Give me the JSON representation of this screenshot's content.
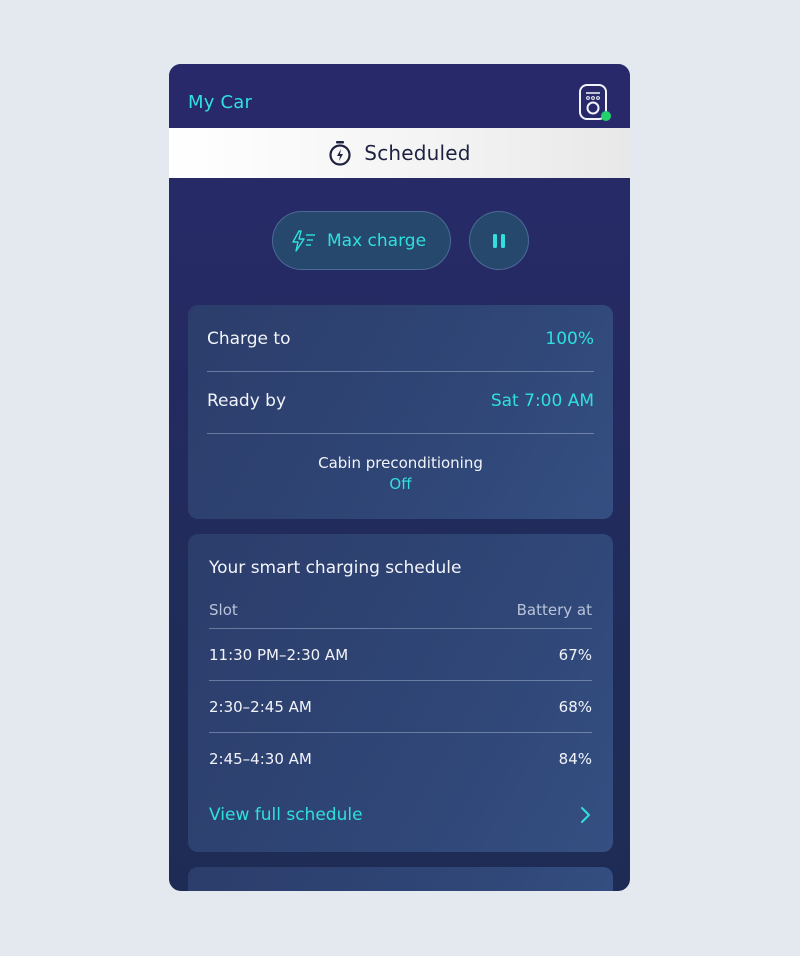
{
  "header": {
    "title": "My Car",
    "charger_status_color": "#22d36a"
  },
  "status": {
    "label": "Scheduled",
    "icon": "stopwatch-bolt-icon"
  },
  "actions": {
    "max_charge_label": "Max charge",
    "max_charge_icon": "lightning-bolt-icon",
    "pause_icon": "pause-icon"
  },
  "charge_settings": {
    "charge_to_label": "Charge to",
    "charge_to_value": "100%",
    "ready_by_label": "Ready by",
    "ready_by_value": "Sat 7:00 AM",
    "cabin_label": "Cabin preconditioning",
    "cabin_value": "Off"
  },
  "schedule": {
    "title": "Your smart charging schedule",
    "col_slot": "Slot",
    "col_battery": "Battery at",
    "rows": [
      {
        "slot": "11:30 PM–2:30 AM",
        "battery": "67%"
      },
      {
        "slot": "2:30–2:45 AM",
        "battery": "68%"
      },
      {
        "slot": "2:45–4:30 AM",
        "battery": "84%"
      }
    ],
    "view_full_label": "View full schedule"
  },
  "colors": {
    "accent": "#2fe0de",
    "background": "#e3e9ef",
    "panel": "#27296a"
  }
}
